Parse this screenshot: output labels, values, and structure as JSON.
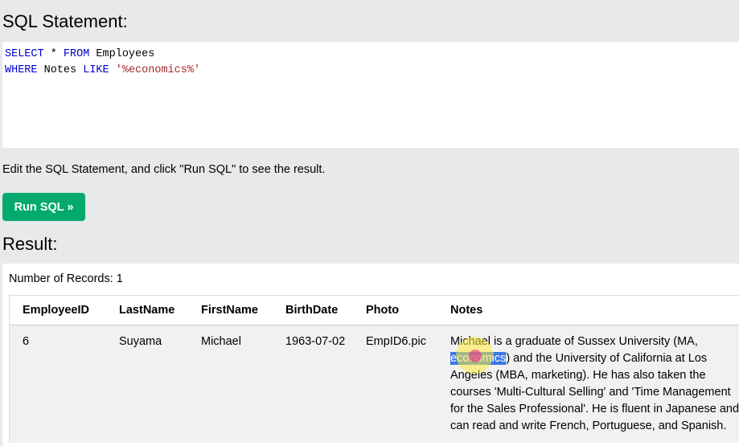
{
  "headings": {
    "sql": "SQL Statement:",
    "result": "Result:"
  },
  "sql": {
    "line1": {
      "kw1": "SELECT",
      "star": " * ",
      "kw2": "FROM",
      "table": " Employees"
    },
    "line2": {
      "kw1": "WHERE",
      "col": " Notes ",
      "kw2": "LIKE",
      "space": " ",
      "pattern": "'%economics%'"
    }
  },
  "instruction": "Edit the SQL Statement, and click \"Run SQL\" to see the result.",
  "run_button": "Run SQL »",
  "records_label": "Number of Records: 1",
  "table": {
    "headers": [
      "EmployeeID",
      "LastName",
      "FirstName",
      "BirthDate",
      "Photo",
      "Notes"
    ],
    "row": {
      "id": "6",
      "last": "Suyama",
      "first": "Michael",
      "birth": "1963-07-02",
      "photo": "EmpID6.pic",
      "notes_before": "Michael is a graduate of Sussex University (MA, ",
      "notes_highlight": "economics",
      "notes_after": ") and the University of California at Los Angeles (MBA, marketing). He has also taken the courses 'Multi-Cultural Selling' and 'Time Management for the Sales Professional'. He is fluent in Japanese and can read and write French, Portuguese, and Spanish."
    }
  },
  "colors": {
    "button": "#04aa6d",
    "keyword": "#0000cd",
    "string": "#a52a2a",
    "highlight": "#3b78e7",
    "page_bg": "#e7e9eb"
  }
}
